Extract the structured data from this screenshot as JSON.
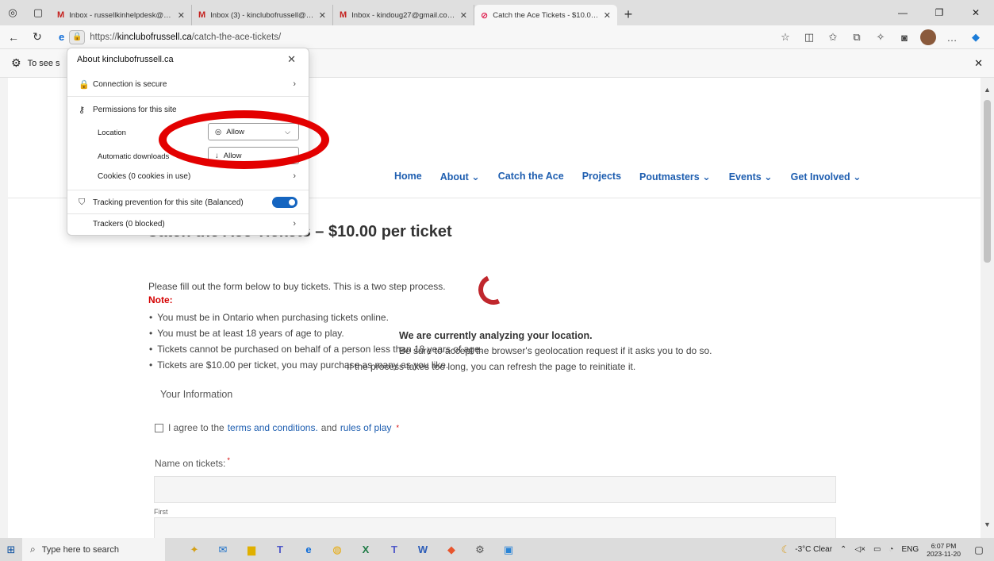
{
  "browser": {
    "tabs": [
      {
        "favicon": "M",
        "title": "Inbox - russellkinhelpdesk@gma"
      },
      {
        "favicon": "M",
        "title": "Inbox (3) - kinclubofrussell@gm"
      },
      {
        "favicon": "M",
        "title": "Inbox - kindoug27@gmail.com -"
      },
      {
        "favicon": "⊘",
        "title": "Catch the Ace Tickets - $10.00 pe",
        "active": true
      }
    ],
    "url_prefix": "https://",
    "url_host": "kinclubofrussell.ca",
    "url_path": "/catch-the-ace-tickets/",
    "infobar_text": "To see s"
  },
  "site_info_popup": {
    "title": "About kinclubofrussell.ca",
    "connection": "Connection is secure",
    "permissions_title": "Permissions for this site",
    "location_label": "Location",
    "location_value": "Allow",
    "downloads_label": "Automatic downloads",
    "downloads_value": "Allow",
    "cookies": "Cookies (0 cookies in use)",
    "tracking": "Tracking prevention for this site (Balanced)",
    "tracking_on": true,
    "trackers": "Trackers (0 blocked)"
  },
  "site_nav": [
    "Home",
    "About ⌄",
    "Catch the Ace",
    "Projects",
    "Poutmasters ⌄",
    "Events ⌄",
    "Get Involved ⌄"
  ],
  "page": {
    "title": "Catch the Ace Tickets – $10.00 per ticket",
    "intro": "Please fill out the form below to buy tickets. This is a two step process.",
    "note_label": "Note:",
    "rules": [
      "You must be in Ontario when purchasing tickets online.",
      "You must be at least 18 years of age to play.",
      "Tickets cannot be purchased on behalf of a person less than 18 years of age.",
      "Tickets are $10.00 per ticket, you may purchase as many as you like."
    ],
    "analyzing_title": "We are currently analyzing your location.",
    "analyzing_line1": "Be sure to accept the browser's geolocation request if it asks you to do so.",
    "analyzing_line2": "If the process takes too long, you can refresh the page to reinitiate it.",
    "your_information": "Your Information",
    "agree_prefix": "I agree to the",
    "terms_link": "terms and conditions.",
    "agree_and": "and",
    "rules_link": "rules of play",
    "name_label": "Name on tickets:",
    "first_label": "First"
  },
  "taskbar": {
    "search_placeholder": "Type here to search",
    "weather": "-3°C  Clear",
    "language": "ENG",
    "time": "6:07 PM",
    "date": "2023-11-20"
  }
}
